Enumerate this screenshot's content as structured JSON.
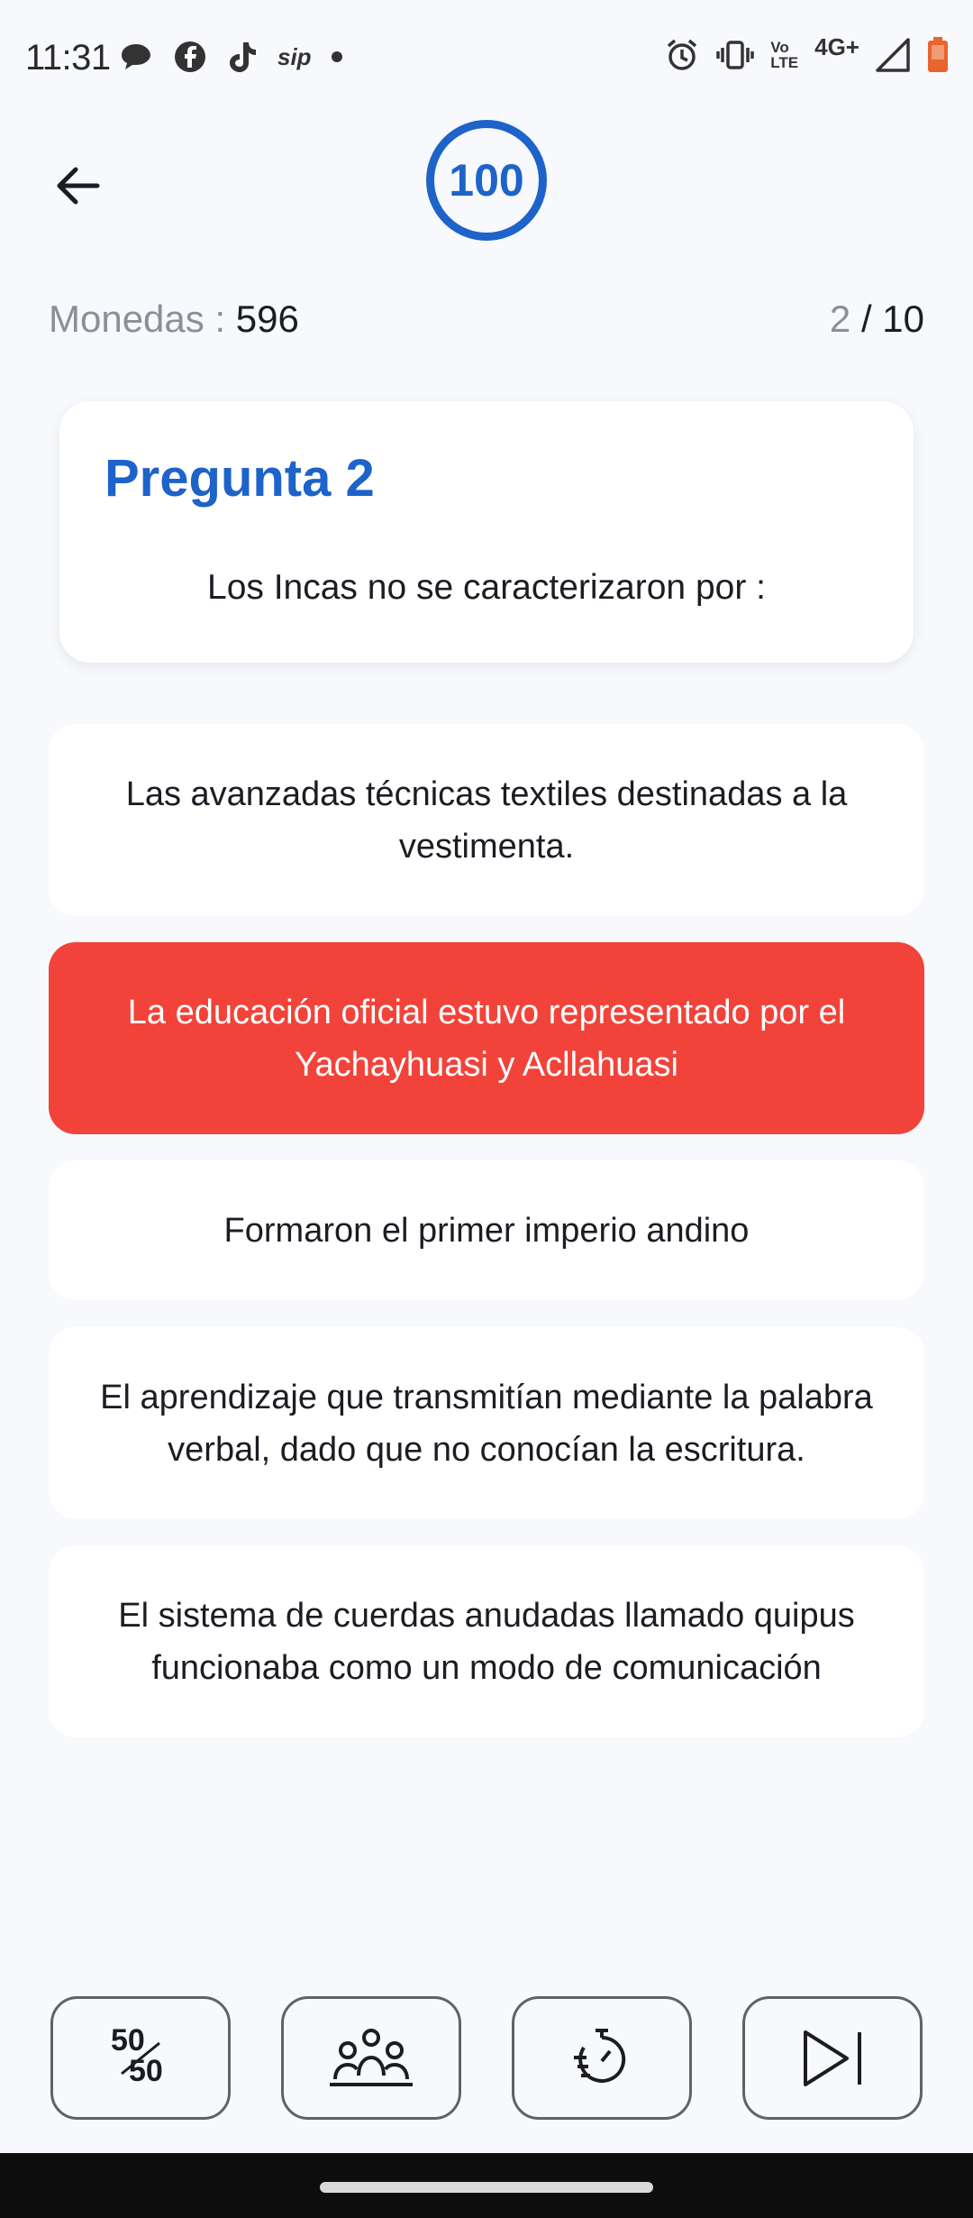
{
  "status_bar": {
    "time": "11:31",
    "sip_label": "sip",
    "volte_top": "Vo",
    "volte_bottom": "LTE",
    "network": "4G+",
    "icons_left": [
      "chat-bubble-icon",
      "facebook-icon",
      "tiktok-icon",
      "sip-icon",
      "dot-icon"
    ],
    "icons_right": [
      "alarm-icon",
      "vibrate-icon",
      "volte-icon",
      "signal-icon",
      "battery-icon"
    ]
  },
  "header": {
    "back_icon": "arrow-left-icon",
    "timer_value": "100",
    "accent_color": "#1d63c9"
  },
  "stats": {
    "coins_label": "Monedas :",
    "coins_value": "596",
    "progress_current": "2",
    "progress_separator": "/",
    "progress_total": "10"
  },
  "question": {
    "title": "Pregunta 2",
    "text": "Los Incas no se caracterizaron por :"
  },
  "answers": [
    {
      "text": "Las avanzadas técnicas textiles destinadas a la vestimenta.",
      "state": "default"
    },
    {
      "text": "La educación oficial estuvo representado por el Yachayhuasi y Acllahuasi",
      "state": "wrong",
      "color": "#f2433a"
    },
    {
      "text": "Formaron el primer imperio andino",
      "state": "default"
    },
    {
      "text": "El aprendizaje que transmitían mediante la palabra verbal, dado que no conocían la escritura.",
      "state": "default"
    },
    {
      "text": "El sistema de cuerdas anudadas llamado quipus funcionaba como un modo de comunicación",
      "state": "default"
    }
  ],
  "toolbar": {
    "fifty_top": "50",
    "fifty_bottom": "50",
    "buttons": [
      "fifty-fifty-icon",
      "audience-icon",
      "add-time-icon",
      "skip-icon"
    ]
  }
}
